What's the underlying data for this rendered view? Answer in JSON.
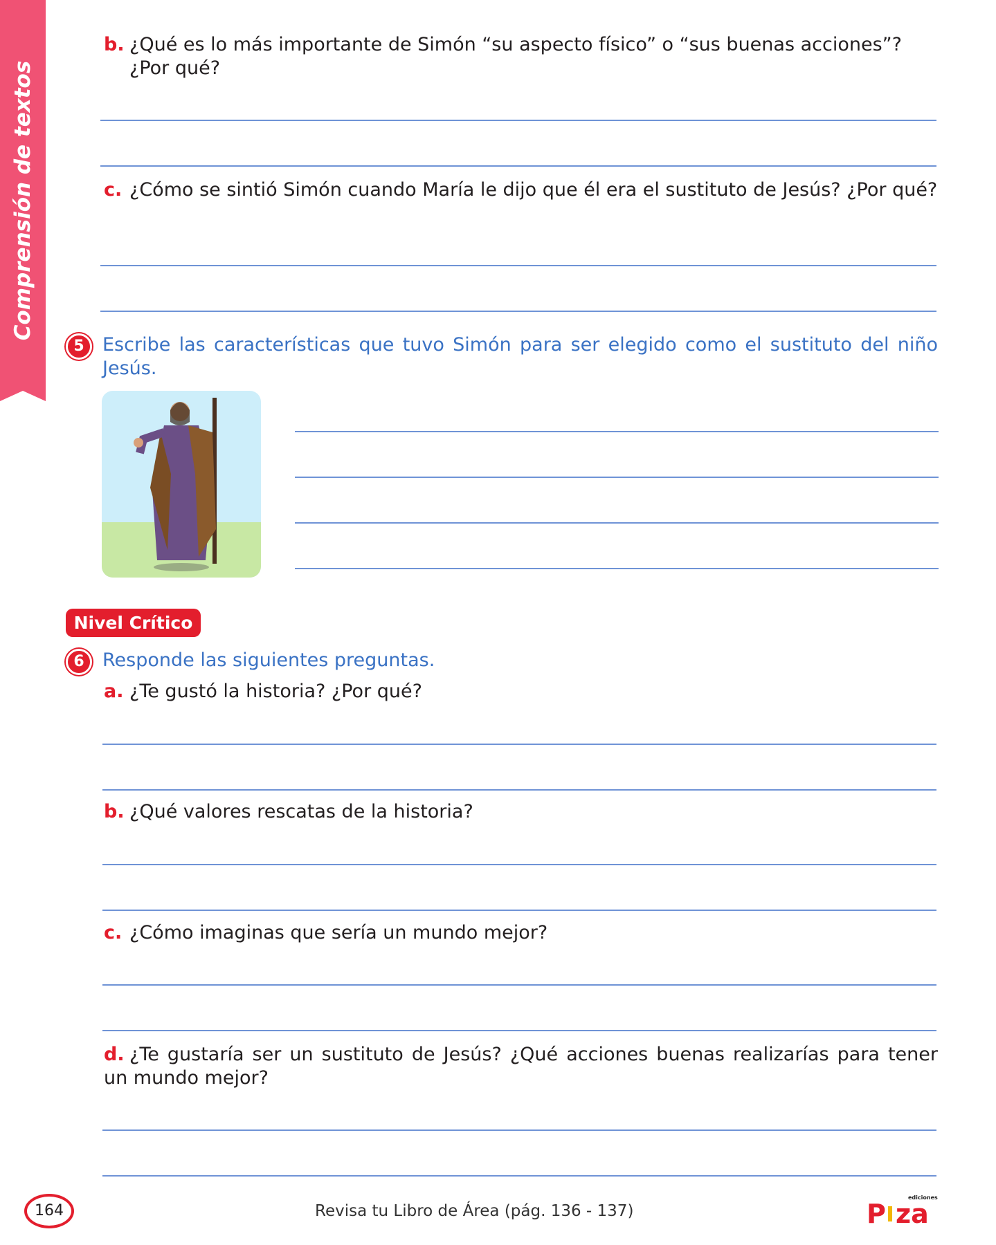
{
  "sidebar": {
    "label": "Comprensión de textos"
  },
  "q4b": {
    "letter": "b.",
    "text": "¿Qué es lo más importante de Simón “su aspecto físico” o “sus buenas acciones”?",
    "text2": "¿Por qué?"
  },
  "q4c": {
    "letter": "c.",
    "text": "¿Cómo se sintió Simón cuando María le dijo que él era el sustituto de Jesús? ¿Por qué?"
  },
  "task5": {
    "number": "5",
    "text": "Escribe las características que tuvo Simón para ser elegido como el sustituto del niño Jesús."
  },
  "badge": {
    "label": "Nivel Crítico"
  },
  "task6": {
    "number": "6",
    "text": "Responde las siguientes preguntas.",
    "questions": [
      {
        "letter": "a.",
        "text": "¿Te gustó la historia? ¿Por qué?"
      },
      {
        "letter": "b.",
        "text": "¿Qué valores rescatas de la historia?"
      },
      {
        "letter": "c.",
        "text": "¿Cómo imaginas que sería un mundo mejor?"
      },
      {
        "letter": "d.",
        "text": "¿Te gustaría ser un sustituto de Jesús? ¿Qué acciones buenas realizarías para tener un mundo mejor?"
      }
    ]
  },
  "footer": {
    "page": "164",
    "text": "Revisa tu Libro de Área (pág. 136 - 137)",
    "logo": "ediciones Piza"
  },
  "colors": {
    "accent_red": "#e31e2d",
    "ribbon": "#f05274",
    "task_blue": "#3a72c4",
    "line_blue": "#6f93d6"
  }
}
